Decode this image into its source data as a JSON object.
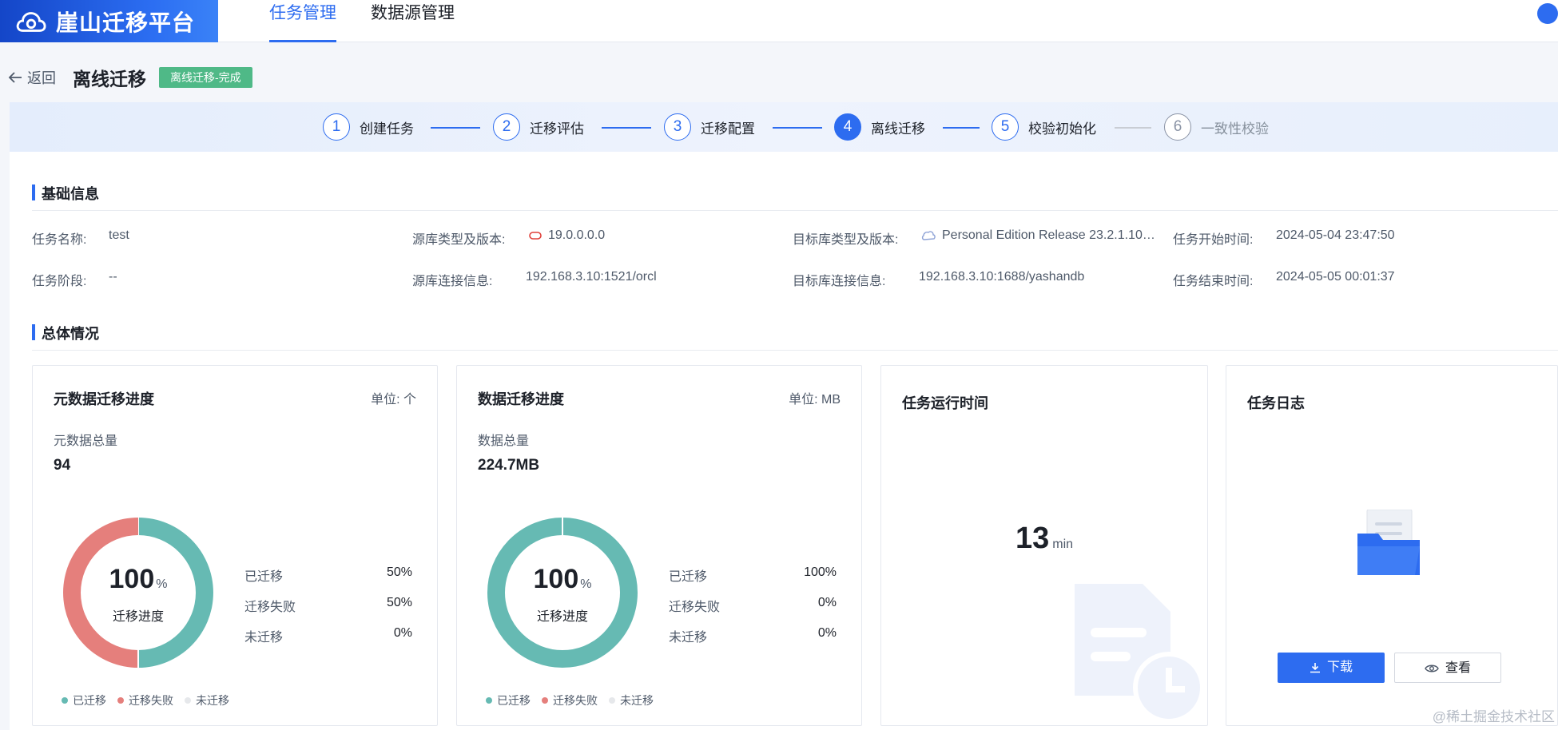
{
  "brand": {
    "name": "崖山迁移平台"
  },
  "nav": {
    "tabs": [
      {
        "label": "任务管理",
        "active": true
      },
      {
        "label": "数据源管理",
        "active": false
      }
    ]
  },
  "header": {
    "back_label": "返回",
    "title": "离线迁移",
    "status": "离线迁移-完成"
  },
  "steps": [
    {
      "num": "1",
      "label": "创建任务",
      "state": "done"
    },
    {
      "num": "2",
      "label": "迁移评估",
      "state": "done"
    },
    {
      "num": "3",
      "label": "迁移配置",
      "state": "done"
    },
    {
      "num": "4",
      "label": "离线迁移",
      "state": "current"
    },
    {
      "num": "5",
      "label": "校验初始化",
      "state": "done"
    },
    {
      "num": "6",
      "label": "一致性校验",
      "state": "pending"
    }
  ],
  "basic": {
    "title": "基础信息",
    "task_name_label": "任务名称:",
    "task_name": "test",
    "task_stage_label": "任务阶段:",
    "task_stage": "--",
    "src_type_label": "源库类型及版本:",
    "src_type": "19.0.0.0.0",
    "src_conn_label": "源库连接信息:",
    "src_conn": "192.168.3.10:1521/orcl",
    "dst_type_label": "目标库类型及版本:",
    "dst_type": "Personal Edition Release 23.2.1.10…",
    "dst_conn_label": "目标库连接信息:",
    "dst_conn": "192.168.3.10:1688/yashandb",
    "start_label": "任务开始时间:",
    "start": "2024-05-04 23:47:50",
    "end_label": "任务结束时间:",
    "end": "2024-05-05 00:01:37"
  },
  "overview": {
    "title": "总体情况"
  },
  "meta_card": {
    "title": "元数据迁移进度",
    "unit": "单位: 个",
    "sub": "元数据总量",
    "total": "94",
    "pct": "100",
    "pct_unit": "%",
    "caption": "迁移进度",
    "rows": [
      {
        "label": "已迁移",
        "value": "50%"
      },
      {
        "label": "迁移失败",
        "value": "50%"
      },
      {
        "label": "未迁移",
        "value": "0%"
      }
    ],
    "fractions": [
      0.5,
      0.5,
      0
    ]
  },
  "data_card": {
    "title": "数据迁移进度",
    "unit": "单位: MB",
    "sub": "数据总量",
    "total": "224.7MB",
    "pct": "100",
    "pct_unit": "%",
    "caption": "迁移进度",
    "rows": [
      {
        "label": "已迁移",
        "value": "100%"
      },
      {
        "label": "迁移失败",
        "value": "0%"
      },
      {
        "label": "未迁移",
        "value": "0%"
      }
    ],
    "fractions": [
      1,
      0,
      0
    ]
  },
  "legend": [
    {
      "label": "已迁移",
      "color": "#66bab3"
    },
    {
      "label": "迁移失败",
      "color": "#e57f7c"
    },
    {
      "label": "未迁移",
      "color": "#e6e8eb"
    }
  ],
  "runtime_card": {
    "title": "任务运行时间",
    "value": "13",
    "unit": "min"
  },
  "log_card": {
    "title": "任务日志",
    "download_label": "下载",
    "view_label": "查看"
  },
  "colors": {
    "accent": "#2d6cf0",
    "success": "#4fb987",
    "migrated": "#66bab3",
    "failed": "#e57f7c"
  },
  "watermark": "@稀土掘金技术社区"
}
